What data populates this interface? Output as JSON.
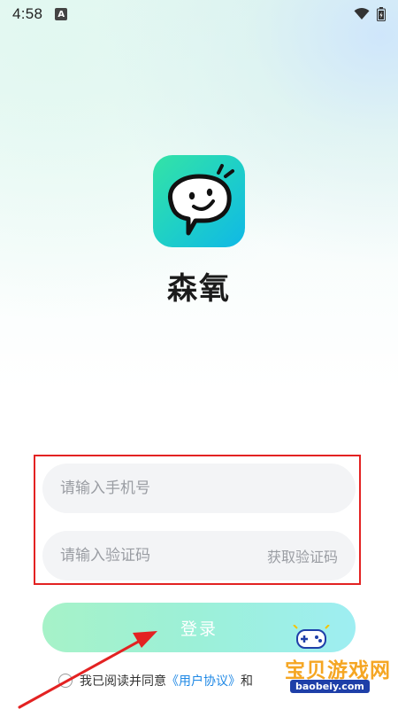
{
  "status_bar": {
    "time": "4:58",
    "notification_icon": "a-letter-icon",
    "wifi_icon": "wifi-icon",
    "battery_icon": "battery-icon"
  },
  "app": {
    "name": "森氧",
    "logo_icon": "smiling-speech-bubble-icon",
    "brand_colors": [
      "#34e3a6",
      "#10b8e6"
    ]
  },
  "form": {
    "phone_placeholder": "请输入手机号",
    "phone_value": "",
    "code_placeholder": "请输入验证码",
    "code_value": "",
    "get_code_label": "获取验证码",
    "highlight_color": "#e32222"
  },
  "login": {
    "label": "登录"
  },
  "agreement": {
    "prefix": "我已阅读并同意",
    "user_agreement": "《用户协议》",
    "and": "和",
    "checked": false
  },
  "watermark": {
    "text": "宝贝游戏网",
    "url": "baobeiy.com"
  },
  "annotation": {
    "arrow_color": "#e32222"
  }
}
